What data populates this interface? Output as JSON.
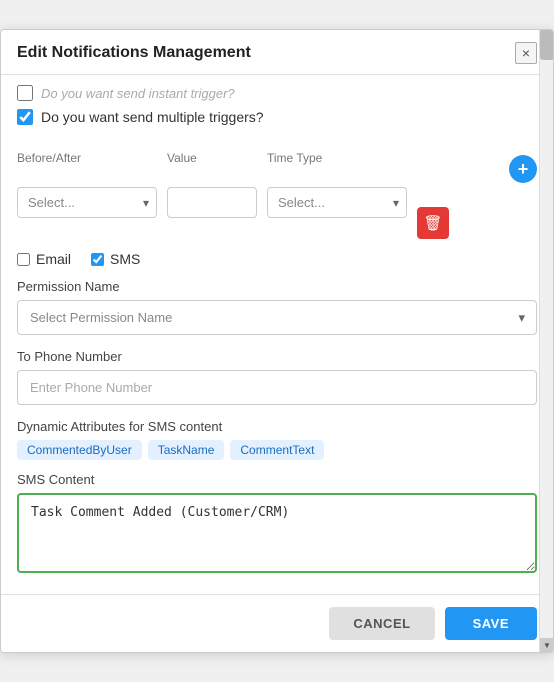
{
  "modal": {
    "title": "Edit Notifications Management",
    "close_label": "×"
  },
  "checkboxes": {
    "instant_trigger": {
      "label": "Do you want send instant trigger?",
      "checked": false
    },
    "multiple_triggers": {
      "label": "Do you want send multiple triggers?",
      "checked": true
    }
  },
  "trigger_fields": {
    "before_after_label": "Before/After",
    "value_label": "Value",
    "time_type_label": "Time Type",
    "select_placeholder": "Select...",
    "add_icon": "+",
    "delete_icon": "🗑"
  },
  "channels": {
    "email_label": "Email",
    "email_checked": false,
    "sms_label": "SMS",
    "sms_checked": true
  },
  "permission": {
    "label": "Permission Name",
    "placeholder": "Select Permission Name"
  },
  "phone": {
    "label": "To Phone Number",
    "placeholder": "Enter Phone Number"
  },
  "dynamic_attrs": {
    "label": "Dynamic Attributes for SMS content",
    "tags": [
      "CommentedByUser",
      "TaskName",
      "CommentText"
    ]
  },
  "sms_content": {
    "label": "SMS Content",
    "value": "Task Comment Added (Customer/CRM)"
  },
  "footer": {
    "cancel_label": "CANCEL",
    "save_label": "SAVE"
  }
}
